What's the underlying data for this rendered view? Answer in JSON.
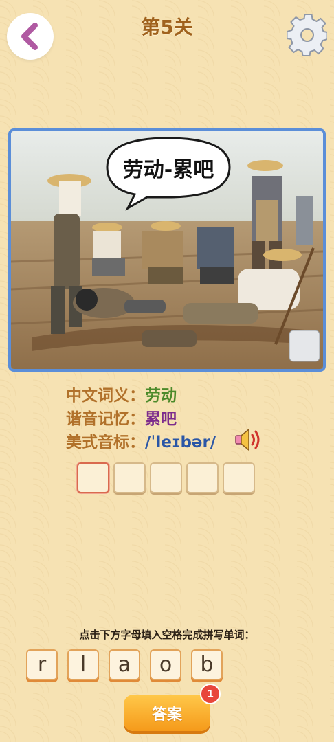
{
  "header": {
    "title": "第5关"
  },
  "picture": {
    "speech_bubble": "劳动-累吧"
  },
  "info": {
    "meaning_label": "中文词义：",
    "meaning_value": "劳动",
    "mnemonic_label": "谐音记忆：",
    "mnemonic_value": "累吧",
    "phonetic_label": "美式音标：",
    "phonetic_value": "/ˈleɪbər/"
  },
  "instruction": "点击下方字母填入空格完成拼写单词：",
  "letters": [
    "r",
    "l",
    "a",
    "o",
    "b"
  ],
  "answer": {
    "label": "答案",
    "badge_count": "1"
  },
  "colors": {
    "accent": "#f59a1a",
    "frame": "#5b8ed8",
    "background": "#f6e2b3"
  },
  "icons": [
    "chevron-left-icon",
    "gear-icon",
    "speaker-icon"
  ]
}
